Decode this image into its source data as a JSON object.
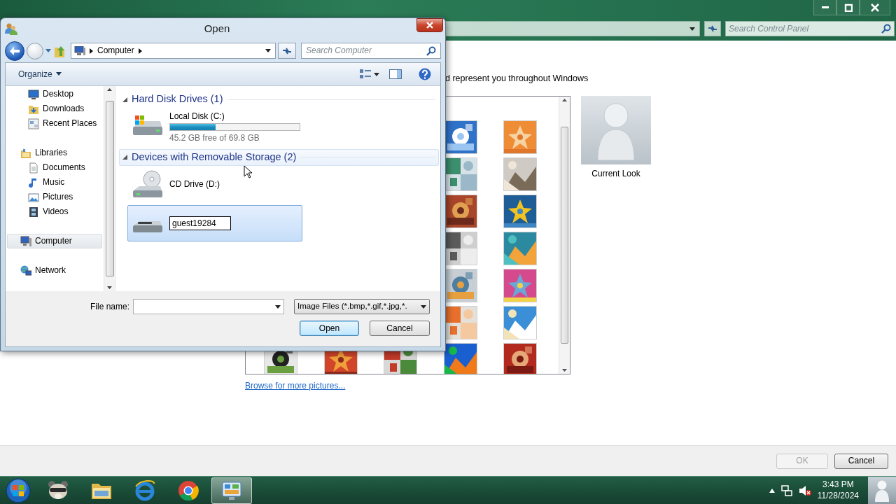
{
  "control_panel": {
    "search": {
      "placeholder": "Search Control Panel"
    },
    "intro": "d represent you throughout Windows",
    "current_picture": {
      "label": "Current Look"
    },
    "browse_link": "Browse for more pictures...",
    "buttons": [
      {
        "label": "OK",
        "disabled": true
      },
      {
        "label": "Cancel",
        "disabled": false
      }
    ]
  },
  "dialog": {
    "title": "Open",
    "address": [
      "Computer"
    ],
    "search": {
      "placeholder": "Search Computer"
    },
    "organize": "Organize",
    "nav": [
      {
        "children": [
          {
            "kind": "desktop",
            "label": "Desktop",
            "selected": false
          },
          {
            "kind": "downloads",
            "label": "Downloads",
            "selected": false
          },
          {
            "kind": "recent",
            "label": "Recent Places",
            "selected": false
          }
        ]
      },
      {
        "kind": "library",
        "label": "Libraries",
        "selected": false,
        "children": [
          {
            "kind": "documents",
            "label": "Documents",
            "selected": false
          },
          {
            "kind": "music",
            "label": "Music",
            "selected": false
          },
          {
            "kind": "pictures",
            "label": "Pictures",
            "selected": false
          },
          {
            "kind": "videos",
            "label": "Videos",
            "selected": false
          }
        ]
      },
      {
        "kind": "computer",
        "label": "Computer",
        "selected": true
      },
      {
        "kind": "network",
        "label": "Network",
        "selected": false
      }
    ],
    "groups": [
      {
        "label": "Hard Disk Drives (1)",
        "expanded": true,
        "hovered": false,
        "items": [
          {
            "kind": "disk",
            "label": "Local Disk (C:)",
            "level": 0.35,
            "detail": "45.2 GB free of 69.8 GB",
            "selected": false
          }
        ]
      },
      {
        "label": "Devices with Removable Storage (2)",
        "expanded": true,
        "hovered": true,
        "items": [
          {
            "kind": "cd",
            "label": "CD Drive (D:)",
            "selected": false
          },
          {
            "kind": "usb",
            "rename_value": "guest19284",
            "selected": true
          }
        ]
      }
    ],
    "file_name": {
      "label": "File name:"
    },
    "file_type": "Image Files (*.bmp,*.gif,*.jpg,*.",
    "buttons": [
      {
        "label": "Open",
        "default": true
      },
      {
        "label": "Cancel",
        "default": false
      }
    ]
  },
  "taskbar": {
    "apps": [
      {
        "kind": "raccoon",
        "active": false
      },
      {
        "kind": "folder",
        "active": false
      },
      {
        "kind": "ie",
        "active": false
      },
      {
        "kind": "chrome",
        "active": false
      },
      {
        "kind": "control_panel",
        "active": true
      }
    ],
    "clock": {
      "time": "3:43 PM",
      "date": "11/28/2024"
    }
  }
}
